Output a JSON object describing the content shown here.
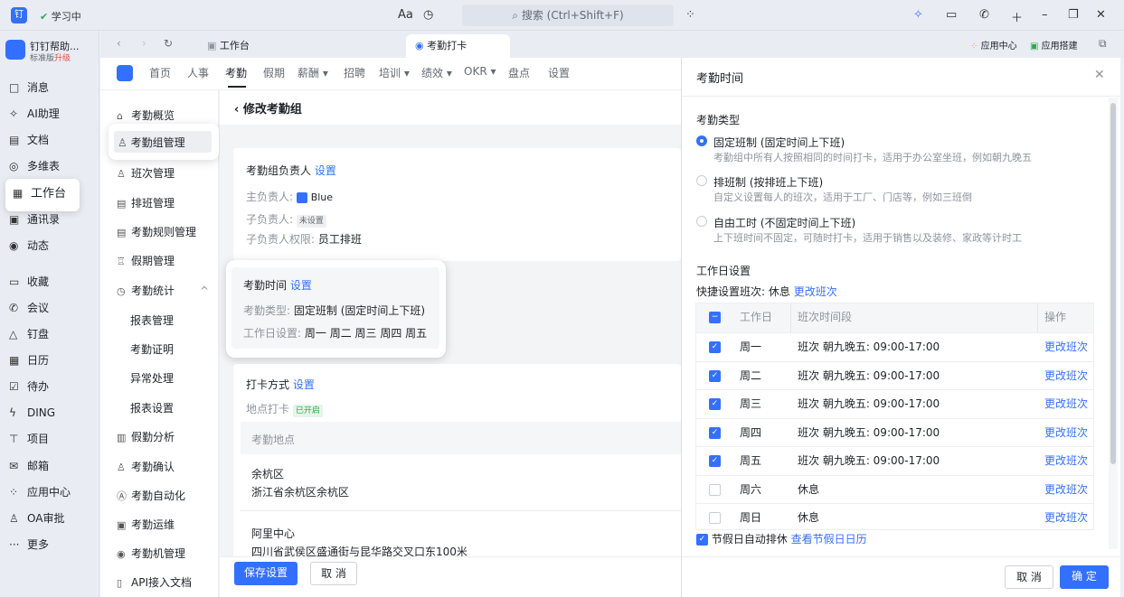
{
  "titlebar": {
    "logo": "钉",
    "study_label": "学习中",
    "search_placeholder": "搜索 (Ctrl+Shift+F)"
  },
  "org": {
    "name": "钉钉帮助...",
    "sub": "标准版",
    "upgrade": "升级"
  },
  "sidebar": {
    "items": [
      {
        "label": "消息",
        "icon": "message-icon",
        "glyph": "□"
      },
      {
        "label": "AI助理",
        "icon": "ai-icon",
        "glyph": "✧"
      },
      {
        "label": "文档",
        "icon": "doc-icon",
        "glyph": "▤"
      },
      {
        "label": "多维表",
        "icon": "table-icon",
        "glyph": "◎"
      },
      {
        "label": "工作台",
        "icon": "workbench-icon",
        "glyph": "▦"
      },
      {
        "label": "通讯录",
        "icon": "contacts-icon",
        "glyph": "▣"
      },
      {
        "label": "动态",
        "icon": "feed-icon",
        "glyph": "◉"
      },
      {
        "label": "收藏",
        "icon": "favorite-icon",
        "glyph": "▭"
      },
      {
        "label": "会议",
        "icon": "meeting-icon",
        "glyph": "✆"
      },
      {
        "label": "钉盘",
        "icon": "drive-icon",
        "glyph": "△"
      },
      {
        "label": "日历",
        "icon": "calendar-icon",
        "glyph": "▦"
      },
      {
        "label": "待办",
        "icon": "todo-icon",
        "glyph": "☑"
      },
      {
        "label": "DING",
        "icon": "ding-icon",
        "glyph": "ϟ"
      },
      {
        "label": "项目",
        "icon": "project-icon",
        "glyph": "⊤"
      },
      {
        "label": "邮箱",
        "icon": "mail-icon",
        "glyph": "✉"
      },
      {
        "label": "应用中心",
        "icon": "apps-icon",
        "glyph": "⁘"
      },
      {
        "label": "OA审批",
        "icon": "approval-icon",
        "glyph": "♙"
      },
      {
        "label": "更多",
        "icon": "more-icon",
        "glyph": "···"
      }
    ]
  },
  "tabs": {
    "workbench": "工作台",
    "attendance": "考勤打卡",
    "app_center": "应用中心",
    "app_build": "应用搭建"
  },
  "app_nav": [
    "首页",
    "人事",
    "考勤",
    "假期",
    "薪酬 ▾",
    "招聘",
    "培训 ▾",
    "绩效 ▾",
    "OKR ▾",
    "盘点",
    "设置"
  ],
  "subnav": [
    {
      "label": "考勤概览",
      "glyph": "⌂",
      "icon": "home-icon"
    },
    {
      "label": "考勤组管理",
      "glyph": "♙",
      "icon": "group-icon"
    },
    {
      "label": "班次管理",
      "glyph": "♙",
      "icon": "shift-icon"
    },
    {
      "label": "排班管理",
      "glyph": "▤",
      "icon": "schedule-icon"
    },
    {
      "label": "考勤规则管理",
      "glyph": "▤",
      "icon": "rules-icon"
    },
    {
      "label": "假期管理",
      "glyph": "♖",
      "icon": "holiday-icon"
    },
    {
      "label": "考勤统计",
      "glyph": "◷",
      "icon": "stats-icon"
    },
    {
      "label": "报表管理",
      "glyph": "",
      "icon": ""
    },
    {
      "label": "考勤证明",
      "glyph": "",
      "icon": ""
    },
    {
      "label": "异常处理",
      "glyph": "",
      "icon": ""
    },
    {
      "label": "报表设置",
      "glyph": "",
      "icon": ""
    },
    {
      "label": "假勤分析",
      "glyph": "▥",
      "icon": "analysis-icon"
    },
    {
      "label": "考勤确认",
      "glyph": "♙",
      "icon": "confirm-icon"
    },
    {
      "label": "考勤自动化",
      "glyph": "Ⓐ",
      "icon": "automation-icon"
    },
    {
      "label": "考勤运维",
      "glyph": "▣",
      "icon": "ops-icon"
    },
    {
      "label": "考勤机管理",
      "glyph": "◉",
      "icon": "machine-icon"
    },
    {
      "label": "API接入文档",
      "glyph": "▯",
      "icon": "api-icon"
    }
  ],
  "main": {
    "title": "修改考勤组",
    "owner": {
      "heading": "考勤组负责人",
      "set": "设置",
      "main_label": "主负责人:",
      "main_value": "Blue",
      "sub_label": "子负责人:",
      "sub_value": "未设置",
      "perm_label": "子负责人权限:",
      "perm_value": "员工排班"
    },
    "time": {
      "heading": "考勤时间",
      "set": "设置",
      "type_label": "考勤类型:",
      "type_value": "固定班制 (固定时间上下班)",
      "days_label": "工作日设置:",
      "days_value": "周一 周二 周三 周四 周五"
    },
    "punch": {
      "heading": "打卡方式",
      "set": "设置",
      "loc_label": "地点打卡",
      "loc_tag": "已开启",
      "loc_header": "考勤地点",
      "locations": [
        {
          "name": "余杭区",
          "addr": "浙江省余杭区余杭区"
        },
        {
          "name": "阿里中心",
          "addr": "四川省武侯区盛通街与昆华路交叉口东100米"
        }
      ]
    },
    "save": "保存设置",
    "cancel": "取 消"
  },
  "drawer": {
    "title": "考勤时间",
    "type_heading": "考勤类型",
    "options": [
      {
        "title": "固定班制 (固定时间上下班)",
        "desc": "考勤组中所有人按照相同的时间打卡，适用于办公室坐班，例如朝九晚五",
        "selected": true
      },
      {
        "title": "排班制 (按排班上下班)",
        "desc": "自定义设置每人的班次，适用于工厂、门店等，例如三班倒",
        "selected": false
      },
      {
        "title": "自由工时 (不固定时间上下班)",
        "desc": "上下班时间不固定，可随时打卡，适用于销售以及装修、家政等计时工",
        "selected": false
      }
    ],
    "workday_heading": "工作日设置",
    "quick_label": "快捷设置班次: 休息",
    "quick_link": "更改班次",
    "columns": {
      "day": "工作日",
      "shift": "班次时间段",
      "action": "操作"
    },
    "rows": [
      {
        "day": "周一",
        "shift": "班次 朝九晚五: 09:00-17:00",
        "action": "更改班次",
        "checked": true
      },
      {
        "day": "周二",
        "shift": "班次 朝九晚五: 09:00-17:00",
        "action": "更改班次",
        "checked": true
      },
      {
        "day": "周三",
        "shift": "班次 朝九晚五: 09:00-17:00",
        "action": "更改班次",
        "checked": true
      },
      {
        "day": "周四",
        "shift": "班次 朝九晚五: 09:00-17:00",
        "action": "更改班次",
        "checked": true
      },
      {
        "day": "周五",
        "shift": "班次 朝九晚五: 09:00-17:00",
        "action": "更改班次",
        "checked": true
      },
      {
        "day": "周六",
        "shift": "休息",
        "action": "更改班次",
        "checked": false
      },
      {
        "day": "周日",
        "shift": "休息",
        "action": "更改班次",
        "checked": false
      }
    ],
    "holiday_label": "节假日自动排休",
    "holiday_link": "查看节假日日历",
    "cancel": "取 消",
    "confirm": "确 定"
  },
  "colors": {
    "accent": "#3370ff",
    "tag_green": "#34a853"
  }
}
